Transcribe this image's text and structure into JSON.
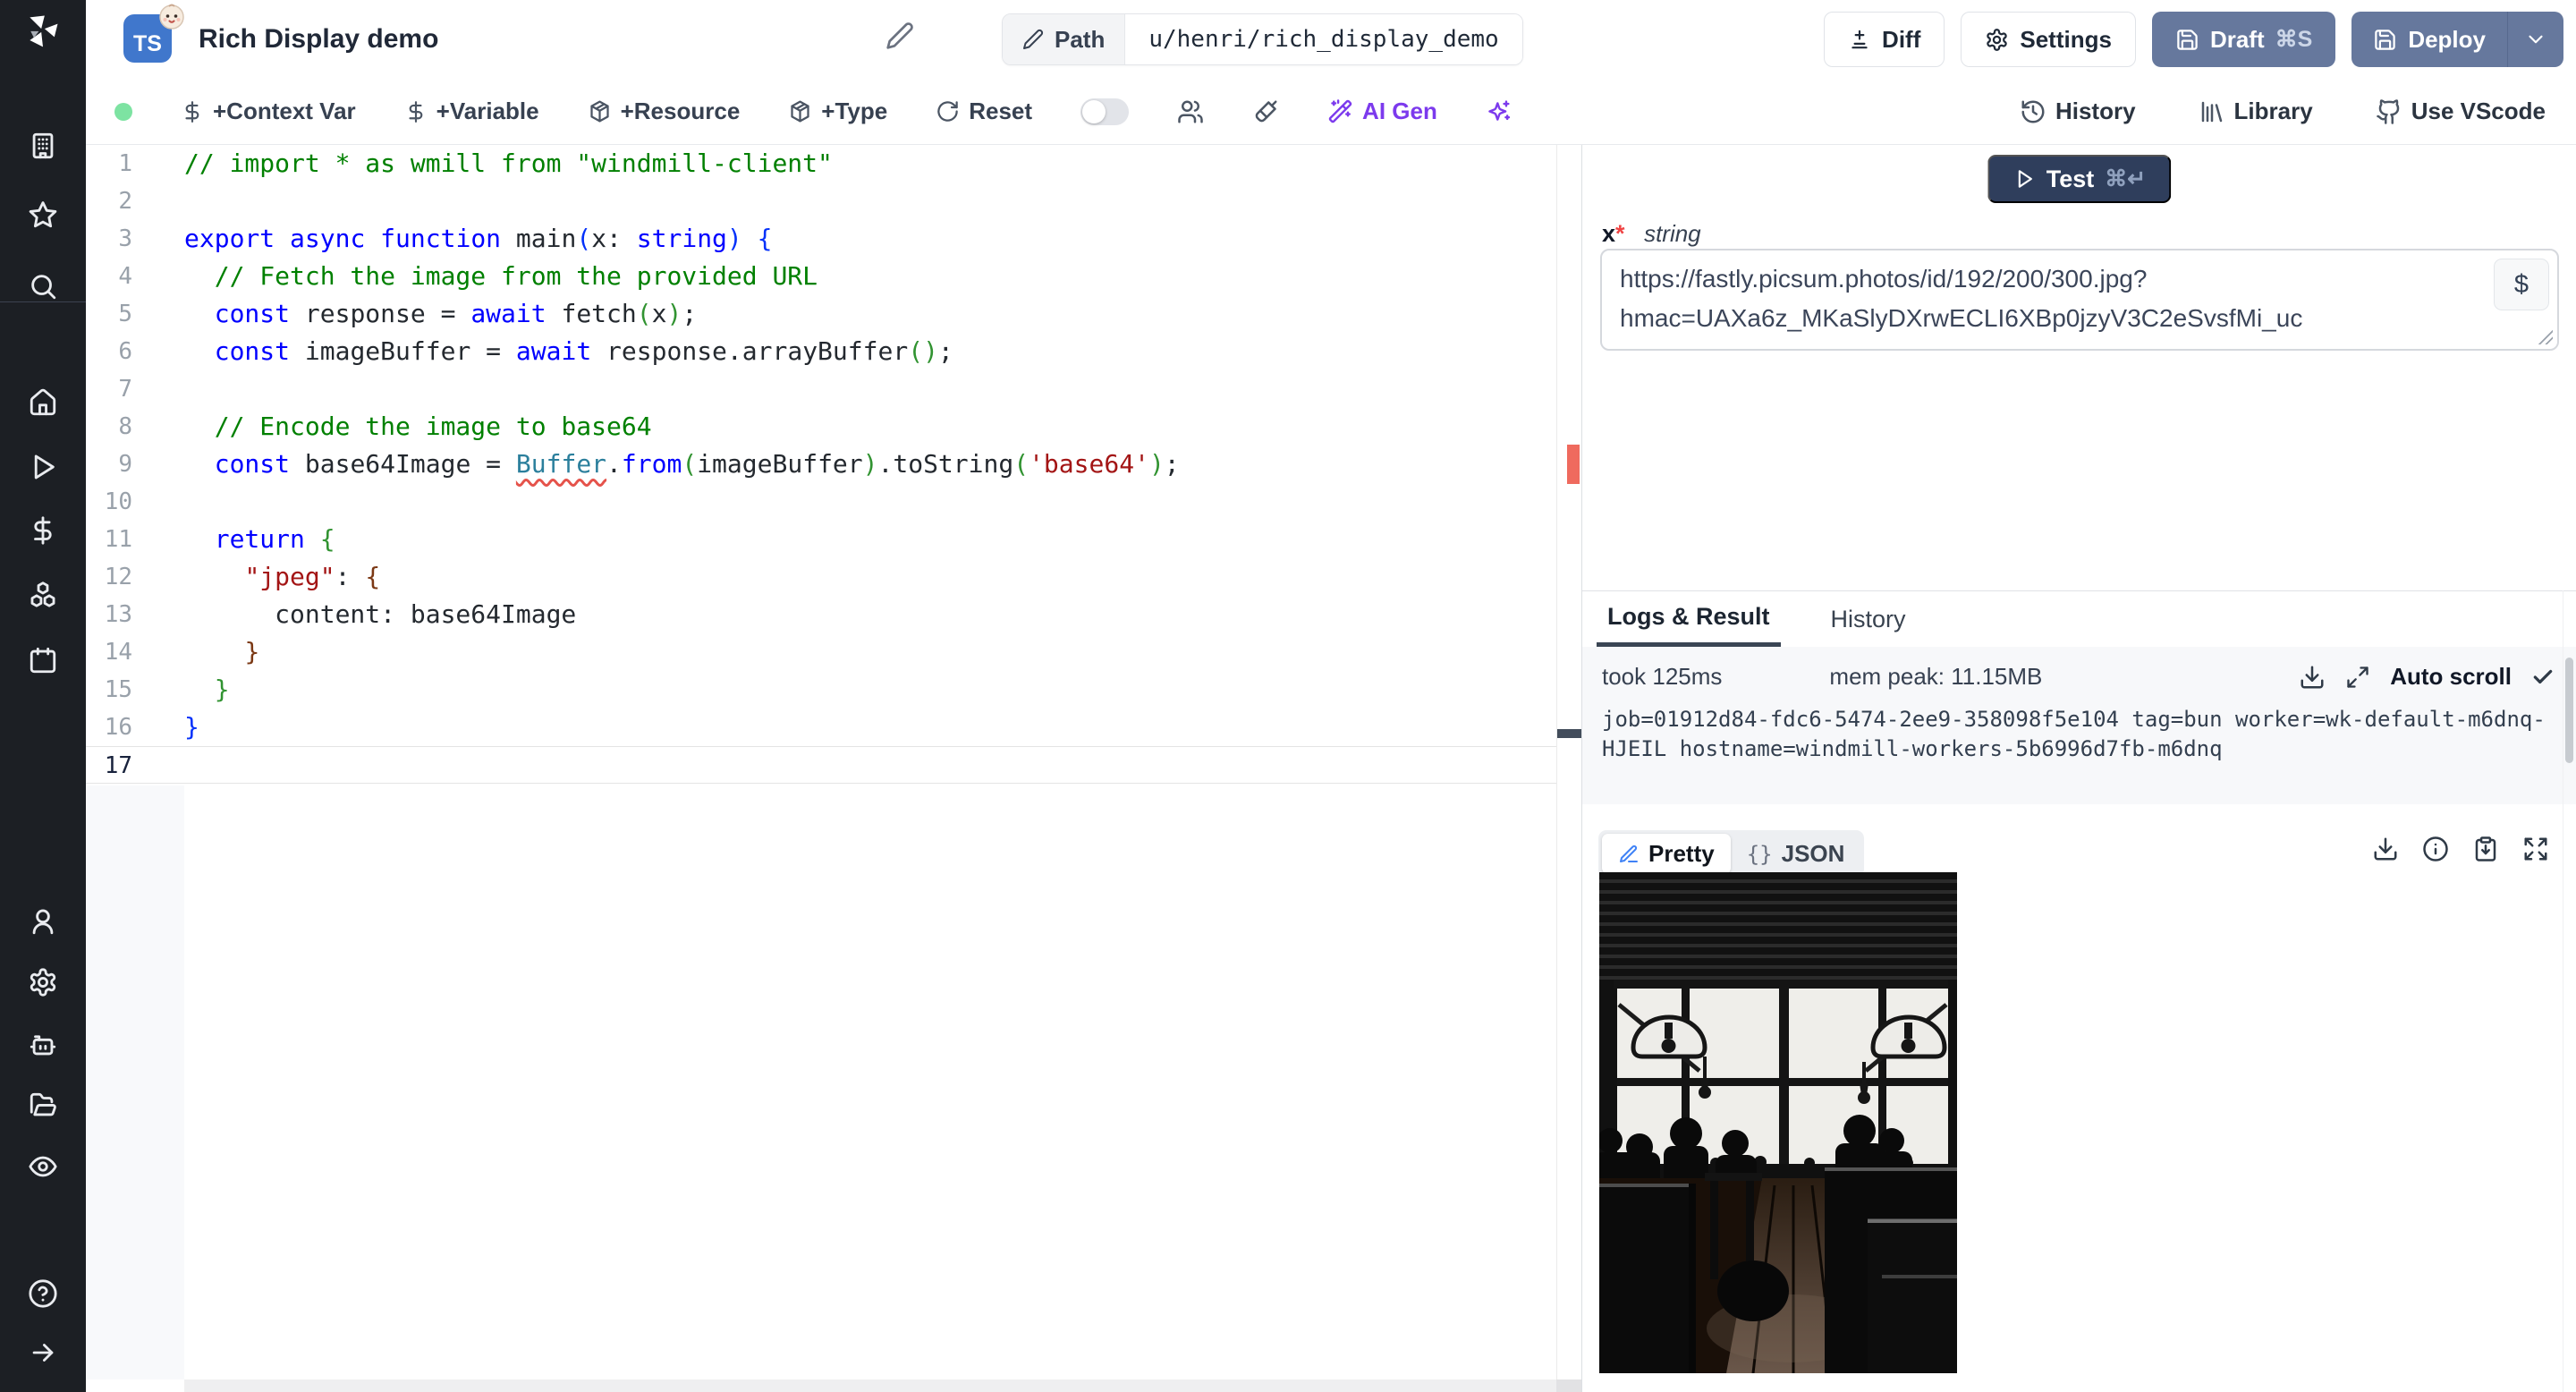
{
  "colors": {
    "accent_ai": "#7c3aed",
    "primary_button": "#66789d",
    "test_button": "#2f3e5c",
    "status_dot": "#7de3a2",
    "error_marker": "#ef6a5e",
    "ts_badge": "#4077cc",
    "tab_underline": "#3a4554",
    "sidebar_bg": "#1c1f24"
  },
  "sidebar": {
    "icons": [
      "windmill-logo",
      "building",
      "star",
      "search",
      "home",
      "play",
      "dollar",
      "boxes",
      "calendar",
      "user",
      "settings",
      "bot",
      "folder-open",
      "eye",
      "help",
      "arrow-right"
    ]
  },
  "header": {
    "lang_badge": "TS",
    "emoji": "👶",
    "title": "Rich Display demo",
    "path_label": "Path",
    "path_value": "u/henri/rich_display_demo",
    "diff": "Diff",
    "settings": "Settings",
    "draft": "Draft",
    "draft_kbd": "⌘S",
    "deploy": "Deploy"
  },
  "toolbar": {
    "add_context_var": "+Context Var",
    "add_variable": "+Variable",
    "add_resource": "+Resource",
    "add_type": "+Type",
    "reset": "Reset",
    "ai_gen": "AI Gen",
    "history": "History",
    "library": "Library",
    "use_vscode": "Use VScode"
  },
  "editor": {
    "lines": [
      {
        "n": 1,
        "t": [
          [
            "c",
            "// import * as wmill from \"windmill-client\""
          ]
        ]
      },
      {
        "n": 2,
        "t": []
      },
      {
        "n": 3,
        "t": [
          [
            "k",
            "export "
          ],
          [
            "k",
            "async "
          ],
          [
            "k",
            "function "
          ],
          [
            "d",
            "main"
          ],
          [
            "b1",
            "("
          ],
          [
            "d",
            "x: "
          ],
          [
            "k",
            "string"
          ],
          [
            "b1",
            ")"
          ],
          [
            "d",
            " "
          ],
          [
            "b1",
            "{"
          ]
        ]
      },
      {
        "n": 4,
        "t": [
          [
            "c",
            "  // Fetch the image from the provided URL"
          ]
        ]
      },
      {
        "n": 5,
        "t": [
          [
            "d",
            "  "
          ],
          [
            "k",
            "const"
          ],
          [
            "d",
            " response = "
          ],
          [
            "k",
            "await"
          ],
          [
            "d",
            " fetch"
          ],
          [
            "b2",
            "("
          ],
          [
            "d",
            "x"
          ],
          [
            "b2",
            ")"
          ],
          [
            "d",
            ";"
          ]
        ]
      },
      {
        "n": 6,
        "t": [
          [
            "d",
            "  "
          ],
          [
            "k",
            "const"
          ],
          [
            "d",
            " imageBuffer = "
          ],
          [
            "k",
            "await"
          ],
          [
            "d",
            " response.arrayBuffer"
          ],
          [
            "b2",
            "("
          ],
          [
            "b2",
            ")"
          ],
          [
            "d",
            ";"
          ]
        ]
      },
      {
        "n": 7,
        "t": []
      },
      {
        "n": 8,
        "t": [
          [
            "c",
            "  // Encode the image to base64"
          ]
        ]
      },
      {
        "n": 9,
        "t": [
          [
            "d",
            "  "
          ],
          [
            "k",
            "const"
          ],
          [
            "d",
            " base64Image = "
          ],
          [
            "e",
            "Buffer"
          ],
          [
            "d",
            "."
          ],
          [
            "k",
            "from"
          ],
          [
            "b2",
            "("
          ],
          [
            "d",
            "imageBuffer"
          ],
          [
            "b2",
            ")"
          ],
          [
            "d",
            ".toString"
          ],
          [
            "b2",
            "("
          ],
          [
            "s",
            "'base64'"
          ],
          [
            "b2",
            ")"
          ],
          [
            "d",
            ";"
          ]
        ]
      },
      {
        "n": 10,
        "t": []
      },
      {
        "n": 11,
        "t": [
          [
            "d",
            "  "
          ],
          [
            "k",
            "return"
          ],
          [
            "d",
            " "
          ],
          [
            "b2",
            "{"
          ]
        ]
      },
      {
        "n": 12,
        "t": [
          [
            "d",
            "    "
          ],
          [
            "s",
            "\"jpeg\""
          ],
          [
            "d",
            ": "
          ],
          [
            "b3",
            "{"
          ]
        ]
      },
      {
        "n": 13,
        "t": [
          [
            "d",
            "      content: base64Image"
          ]
        ]
      },
      {
        "n": 14,
        "t": [
          [
            "d",
            "    "
          ],
          [
            "b3",
            "}"
          ]
        ]
      },
      {
        "n": 15,
        "t": [
          [
            "d",
            "  "
          ],
          [
            "b2",
            "}"
          ]
        ]
      },
      {
        "n": 16,
        "t": [
          [
            "b1",
            "}"
          ]
        ]
      },
      {
        "n": 17,
        "t": [],
        "active": true
      }
    ]
  },
  "run_panel": {
    "test_label": "Test",
    "test_kbd": "⌘↵",
    "arg_name": "x",
    "required_mark": "*",
    "arg_type": "string",
    "arg_value": "https://fastly.picsum.photos/id/192/200/300.jpg?hmac=UAXa6z_MKaSlyDXrwECLI6XBp0jzyV3C2eSvsfMi_uc",
    "insert_var_label": "$"
  },
  "logs_panel": {
    "tab_logs": "Logs & Result",
    "tab_history": "History",
    "took": "took 125ms",
    "mem_peak": "mem peak: 11.15MB",
    "auto_scroll": "Auto scroll",
    "log_text": "job=01912d84-fdc6-5474-2ee9-358098f5e104 tag=bun worker=wk-default-m6dnq-HJEIL hostname=windmill-workers-5b6996d7fb-m6dnq"
  },
  "result_panel": {
    "pretty": "Pretty",
    "json": "JSON",
    "json_icon": "{}",
    "image_alt": "Black and white photo of a cafe interior: silhouettes of people at tables in front of large bright windows with pendant lamps"
  }
}
